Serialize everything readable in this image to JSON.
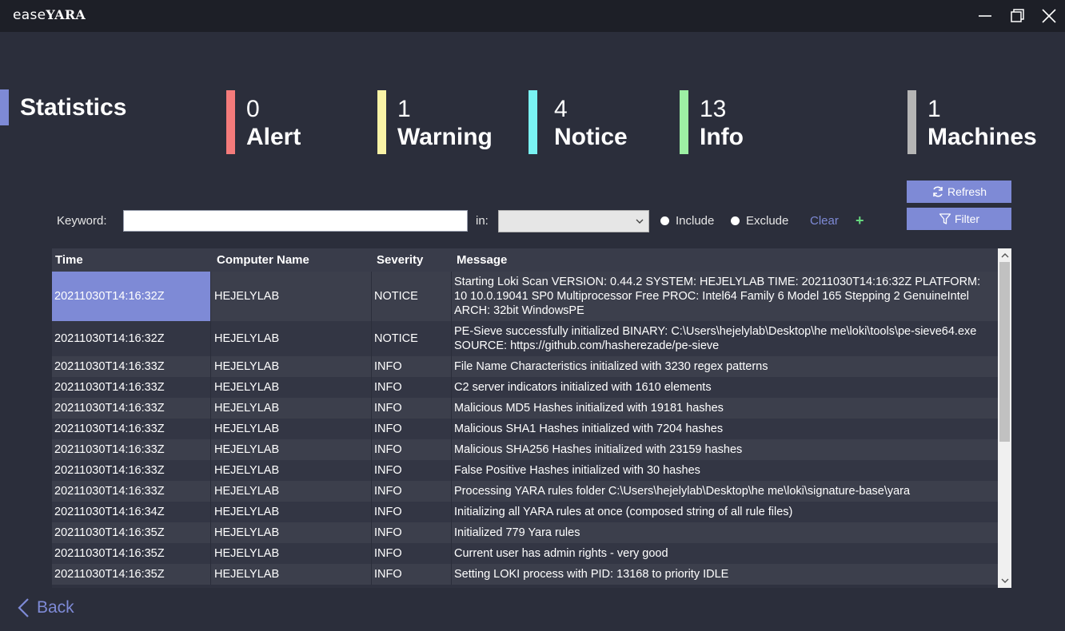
{
  "window": {
    "title_light": "ease",
    "title_bold": "YARA",
    "icons": [
      "minimize-icon",
      "maximize-icon",
      "close-icon"
    ]
  },
  "stats": {
    "title": "Statistics",
    "marker_color": "#7e8ad6",
    "items": [
      {
        "count": "0",
        "label": "Alert",
        "color": "#f47b7b"
      },
      {
        "count": "1",
        "label": "Warning",
        "color": "#f9f3a6"
      },
      {
        "count": "4",
        "label": "Notice",
        "color": "#79f2f2"
      },
      {
        "count": "13",
        "label": "Info",
        "color": "#9df0a4"
      },
      {
        "count": "1",
        "label": "Machines",
        "color": "#b5b5b5"
      }
    ]
  },
  "actions": {
    "refresh_label": "Refresh",
    "filter_label": "Filter"
  },
  "filter": {
    "keyword_label": "Keyword:",
    "keyword_value": "",
    "in_label": "in:",
    "in_value": "",
    "include_label": "Include",
    "exclude_label": "Exclude",
    "clear_label": "Clear",
    "add_label": "+"
  },
  "table": {
    "columns": [
      "Time",
      "Computer Name",
      "Severity",
      "Message"
    ],
    "rows": [
      {
        "time": "20211030T14:16:32Z",
        "computer": "HEJELYLAB",
        "severity": "NOTICE",
        "message": " Starting Loki Scan VERSION: 0.44.2 SYSTEM: HEJELYLAB TIME: 20211030T14:16:32Z PLATFORM: 10 10.0.19041 SP0 Multiprocessor Free PROC: Intel64 Family 6 Model 165 Stepping 2  GenuineIntel ARCH: 32bit WindowsPE"
      },
      {
        "time": "20211030T14:16:32Z",
        "computer": "HEJELYLAB",
        "severity": "NOTICE",
        "message": " PE-Sieve successfully initialized BINARY: C:\\Users\\hejelylab\\Desktop\\he me\\loki\\tools\\pe-sieve64.exe SOURCE: https://github.com/hasherezade/pe-sieve"
      },
      {
        "time": "20211030T14:16:33Z",
        "computer": "HEJELYLAB",
        "severity": "INFO",
        "message": " File Name Characteristics initialized with 3230 regex patterns"
      },
      {
        "time": "20211030T14:16:33Z",
        "computer": "HEJELYLAB",
        "severity": "INFO",
        "message": " C2 server indicators initialized with 1610 elements"
      },
      {
        "time": "20211030T14:16:33Z",
        "computer": "HEJELYLAB",
        "severity": "INFO",
        "message": " Malicious MD5 Hashes initialized with 19181 hashes"
      },
      {
        "time": "20211030T14:16:33Z",
        "computer": "HEJELYLAB",
        "severity": "INFO",
        "message": " Malicious SHA1 Hashes initialized with 7204 hashes"
      },
      {
        "time": "20211030T14:16:33Z",
        "computer": "HEJELYLAB",
        "severity": "INFO",
        "message": " Malicious SHA256 Hashes initialized with 23159 hashes"
      },
      {
        "time": "20211030T14:16:33Z",
        "computer": "HEJELYLAB",
        "severity": "INFO",
        "message": " False Positive Hashes initialized with 30 hashes"
      },
      {
        "time": "20211030T14:16:33Z",
        "computer": "HEJELYLAB",
        "severity": "INFO",
        "message": " Processing YARA rules folder C:\\Users\\hejelylab\\Desktop\\he me\\loki\\signature-base\\yara"
      },
      {
        "time": "20211030T14:16:34Z",
        "computer": "HEJELYLAB",
        "severity": "INFO",
        "message": " Initializing all YARA rules at once (composed string of all rule files)"
      },
      {
        "time": "20211030T14:16:35Z",
        "computer": "HEJELYLAB",
        "severity": "INFO",
        "message": " Initialized 779 Yara rules"
      },
      {
        "time": "20211030T14:16:35Z",
        "computer": "HEJELYLAB",
        "severity": "INFO",
        "message": " Current user has admin rights - very good"
      },
      {
        "time": "20211030T14:16:35Z",
        "computer": "HEJELYLAB",
        "severity": "INFO",
        "message": " Setting LOKI process with PID: 13168 to priority IDLE"
      }
    ]
  },
  "nav": {
    "back_label": "Back"
  }
}
